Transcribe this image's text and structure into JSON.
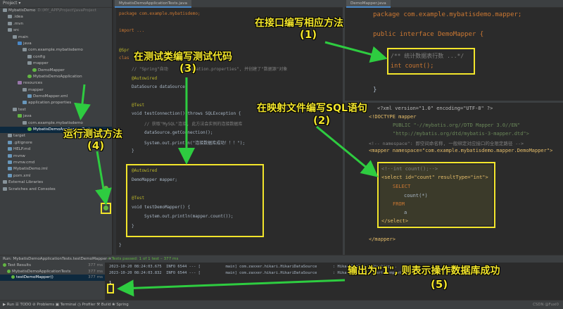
{
  "project_panel": {
    "header": "Project ▾",
    "tree": [
      {
        "label": "MybatisDemo",
        "extra": "D:\\MY_APP\\Project\\JavaProject",
        "icon": "folder",
        "indent": 0
      },
      {
        "label": ".idea",
        "icon": "folder",
        "indent": 1
      },
      {
        "label": ".mvn",
        "icon": "folder",
        "indent": 1
      },
      {
        "label": "src",
        "icon": "folder",
        "indent": 1
      },
      {
        "label": "main",
        "icon": "folder",
        "indent": 2
      },
      {
        "label": "java",
        "icon": "src",
        "indent": 3
      },
      {
        "label": "com.example.mybatisdemo",
        "icon": "folder",
        "indent": 4
      },
      {
        "label": "config",
        "icon": "folder",
        "indent": 5
      },
      {
        "label": "mapper",
        "icon": "folder",
        "indent": 5
      },
      {
        "label": "DemoMapper",
        "icon": "java",
        "indent": 6
      },
      {
        "label": "MybatisDemoApplication",
        "icon": "java",
        "indent": 5
      },
      {
        "label": "resources",
        "icon": "res",
        "indent": 3
      },
      {
        "label": "mapper",
        "icon": "folder",
        "indent": 4
      },
      {
        "label": "DemoMapper.xml",
        "icon": "file",
        "indent": 5
      },
      {
        "label": "application.properties",
        "icon": "file",
        "indent": 4
      },
      {
        "label": "test",
        "icon": "folder",
        "indent": 2
      },
      {
        "label": "java",
        "icon": "test",
        "indent": 3
      },
      {
        "label": "com.example.mybatisdemo",
        "icon": "folder",
        "indent": 4
      },
      {
        "label": "MybatisDemoApplicationTests",
        "icon": "java",
        "indent": 5,
        "selected": true
      },
      {
        "label": "target",
        "icon": "folder",
        "indent": 1
      },
      {
        "label": ".gitignore",
        "icon": "file",
        "indent": 1
      },
      {
        "label": "HELP.md",
        "icon": "file",
        "indent": 1
      },
      {
        "label": "mvnw",
        "icon": "file",
        "indent": 1
      },
      {
        "label": "mvnw.cmd",
        "icon": "file",
        "indent": 1
      },
      {
        "label": "MybatisDemo.iml",
        "icon": "file",
        "indent": 1
      },
      {
        "label": "pom.xml",
        "icon": "file",
        "indent": 1
      },
      {
        "label": "External Libraries",
        "icon": "folder",
        "indent": 0
      },
      {
        "label": "Scratches and Consoles",
        "icon": "folder",
        "indent": 0
      }
    ]
  },
  "tabs": {
    "left": "MybatisDemoApplicationTests.java",
    "right": "DemoMapper.java"
  },
  "editor_left": {
    "l1": "package com.example.mybatisdemo;",
    "l2": "import ...",
    "l3a": "@Spr",
    "l3b": "clas",
    "comment1": "// \"Spring\"自动     application.properties\", 并创建了\"数据源\"对象",
    "autowired1": "@Autowired",
    "ds_line": "DataSource dataSource;",
    "test1": "@Test",
    "testconn": "void testConnection() throws SQLException {",
    "comment2": "// 获取\"MySQL\"连接, 此方法会实例的连接数据库",
    "getconn": "dataSource.getConnection();",
    "println1": "System.out.println(\"连接数据库成功！！！\");",
    "brace1": "}",
    "autowired2": "@Autowired",
    "mapper_line": "DemoMapper mapper;",
    "test2": "@Test",
    "testmapper": "void testDemoMapper() {",
    "println2": "System.out.println(mapper.count());",
    "brace2": "}",
    "brace3": "}"
  },
  "editor_right_top": {
    "l1": "package com.example.mybatisdemo.mapper;",
    "l2": "public interface DemoMapper {",
    "l3": "/** 统计数据表行数 ...*/",
    "l4": "int count();",
    "l5": "}"
  },
  "editor_right_bot": {
    "l1": "<?xml version=\"1.0\" encoding=\"UTF-8\" ?>",
    "l2": "<!DOCTYPE mapper",
    "l3": "PUBLIC \"-//mybatis.org//DTD Mapper 3.0//EN\"",
    "l4": "\"http://mybatis.org/dtd/mybatis-3-mapper.dtd\">",
    "l5": "<!-- namespace\": 即空间命名称, 一般绑定对应接口的全限定路径 -->",
    "l6": "<mapper namespace=\"com.example.mybatisdemo.mapper.DemoMapper\">",
    "l7": "<!--int count();-->",
    "l8": "<select id=\"count\" resultType=\"int\">",
    "l9": "SELECT",
    "l10": "count(*)",
    "l11": "FROM",
    "l12": "a",
    "l13": "</select>",
    "l14": "</mapper>"
  },
  "run": {
    "header": "Run:    MybatisDemoApplicationTests.testDemoMapper  ×",
    "status": "✓ Tests passed: 1 of 1 test – 377 ms",
    "tree": [
      {
        "label": "Test Results",
        "time": "377 ms"
      },
      {
        "label": "MybatisDemoApplicationTests",
        "time": "377 ms"
      },
      {
        "label": "testDemoMapper()",
        "time": "377 ms",
        "selected": true
      }
    ],
    "console": [
      "2023-10-20 08:24:03.675  INFO 6544 --- [           main] com.zaxxer.hikari.HikariDataSource       : HikariPool-1 - Starting...",
      "2023-10-20 08:24:03.832  INFO 6544 --- [           main] com.zaxxer.hikari.HikariDataSource       : HikariPool-1 - Start completed.",
      "1"
    ]
  },
  "status_bar": {
    "text": "▶ Run   ☰ TODO   ⊘ Problems   ▣ Terminal   ◷ Profiler   ⚒ Build   ❀ Spring",
    "right": "CSDN @Fuxi0"
  },
  "annotations": {
    "a1": {
      "text": "在接口编写相应方法",
      "num": "(1)"
    },
    "a2": {
      "text": "在映射文件编写SQL语句",
      "num": "(2)"
    },
    "a3": {
      "text": "在测试类编写测试代码",
      "num": "(3)"
    },
    "a4": {
      "text": "运行测试方法",
      "num": "(4)"
    },
    "a5": {
      "text": "输出为\"1\", 则表示操作数据库成功",
      "num": "(5)"
    }
  },
  "colors": {
    "annotation": "#f2e52b",
    "arrow": "#2ecc40",
    "editor_bg": "#2b2b2b",
    "panel_bg": "#3c3f41"
  }
}
